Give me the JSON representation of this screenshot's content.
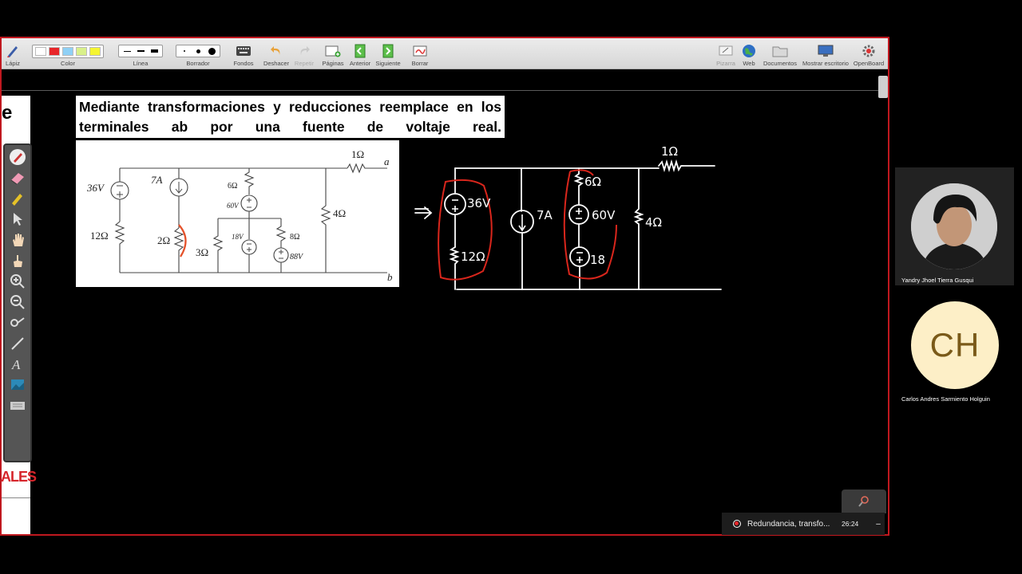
{
  "toolbar": {
    "pencil": "Lápiz",
    "color": "Color",
    "line": "Línea",
    "eraser": "Borrador",
    "backgrounds": "Fondos",
    "undo": "Deshacer",
    "redo": "Repetir",
    "pages": "Páginas",
    "previous": "Anterior",
    "next": "Siguiente",
    "clear": "Borrar",
    "board": "Pizarra",
    "web": "Web",
    "documents": "Documentos",
    "show_desktop": "Mostrar escritorio",
    "openboard": "OpenBoard",
    "colors": [
      "#ffffff",
      "#e8262a",
      "#8fd0f5",
      "#d9f08a",
      "#f5f531"
    ]
  },
  "left_panel": {
    "top_letter": "e",
    "bottom_text": "ALES",
    "bottom_color": "#d6252b"
  },
  "problem": {
    "text": "Mediante transformaciones y reducciones reemplace en los terminales ab por una fuente de voltaje real."
  },
  "circuit": {
    "labels": {
      "v36": "36V",
      "r12": "12Ω",
      "i7": "7A",
      "r2": "2Ω",
      "r6": "6Ω",
      "v60": "60V",
      "r3": "3Ω",
      "v18": "18V",
      "r8": "8Ω",
      "v88": "88V",
      "r4": "4Ω",
      "r1": "1Ω",
      "a": "a",
      "b": "b"
    }
  },
  "handwritten": {
    "r1": "1Ω",
    "v36": "36V",
    "r12": "12Ω",
    "i7": "7A",
    "r6": "6Ω",
    "v60": "60V",
    "v18": "18",
    "r4": "4Ω",
    "ink_color": "#ffffff",
    "highlight_color": "#d9261c"
  },
  "participants": [
    {
      "name": "Yandry Jhoel Tierra Gusqui"
    },
    {
      "initials": "CH",
      "name": "Carlos Andres Sarmiento Holguin"
    }
  ],
  "recording": {
    "title": "Redundancia, transfo...",
    "time": "26:24",
    "menu": "–"
  }
}
